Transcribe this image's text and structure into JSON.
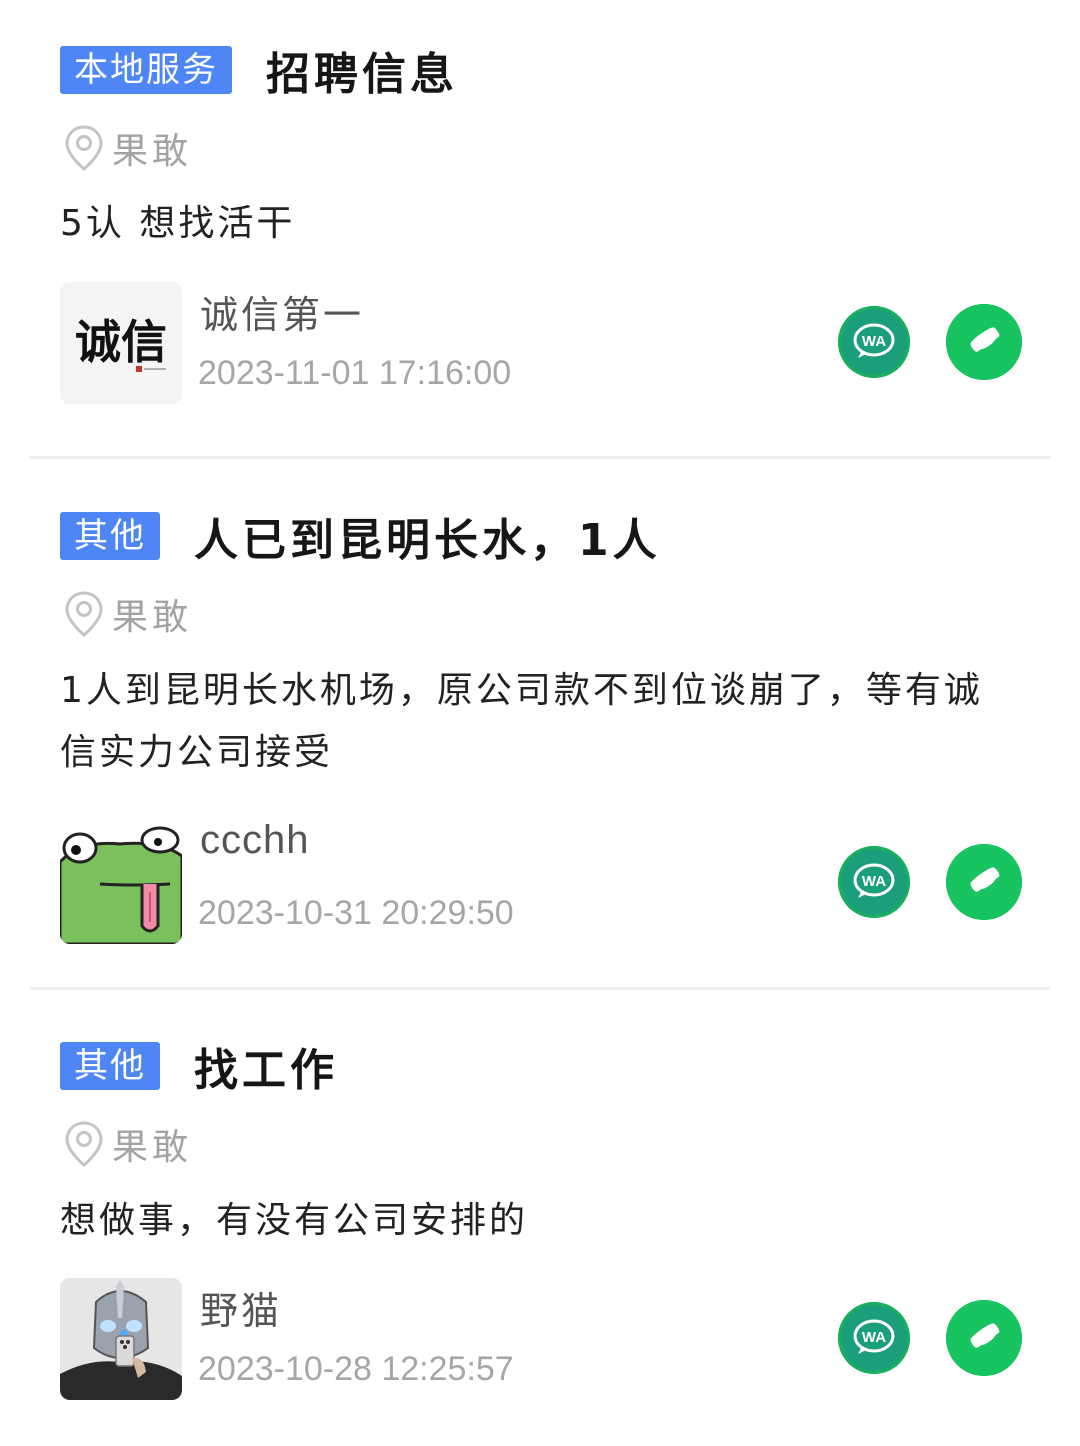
{
  "listings": [
    {
      "tag": "本地服务",
      "title": "招聘信息",
      "location": "果敢",
      "content": "5认  想找活干",
      "user": {
        "name": "诚信第一",
        "avatar_icon": "calligraphy-avatar",
        "avatar_text": "诚信"
      },
      "timestamp": "2023-11-01 17:16:00"
    },
    {
      "tag": "其他",
      "title": "人已到昆明长水，1人",
      "location": "果敢",
      "content": "1人到昆明长水机场，原公司款不到位谈崩了，等有诚信实力公司接受",
      "user": {
        "name": "ccchh",
        "avatar_icon": "frog-avatar"
      },
      "timestamp": "2023-10-31 20:29:50"
    },
    {
      "tag": "其他",
      "title": "找工作",
      "location": "果敢",
      "content": "想做事，有没有公司安排的",
      "user": {
        "name": "野猫",
        "avatar_icon": "photo-avatar"
      },
      "timestamp": "2023-10-28 12:25:57"
    }
  ],
  "actions": {
    "whatsapp_icon": "whatsapp-icon",
    "phone_icon": "phone-icon"
  },
  "colors": {
    "tag_bg": "#4f86f5",
    "whatsapp": "#1ab05b",
    "phone": "#17c45f",
    "muted": "#a6a6a6"
  }
}
